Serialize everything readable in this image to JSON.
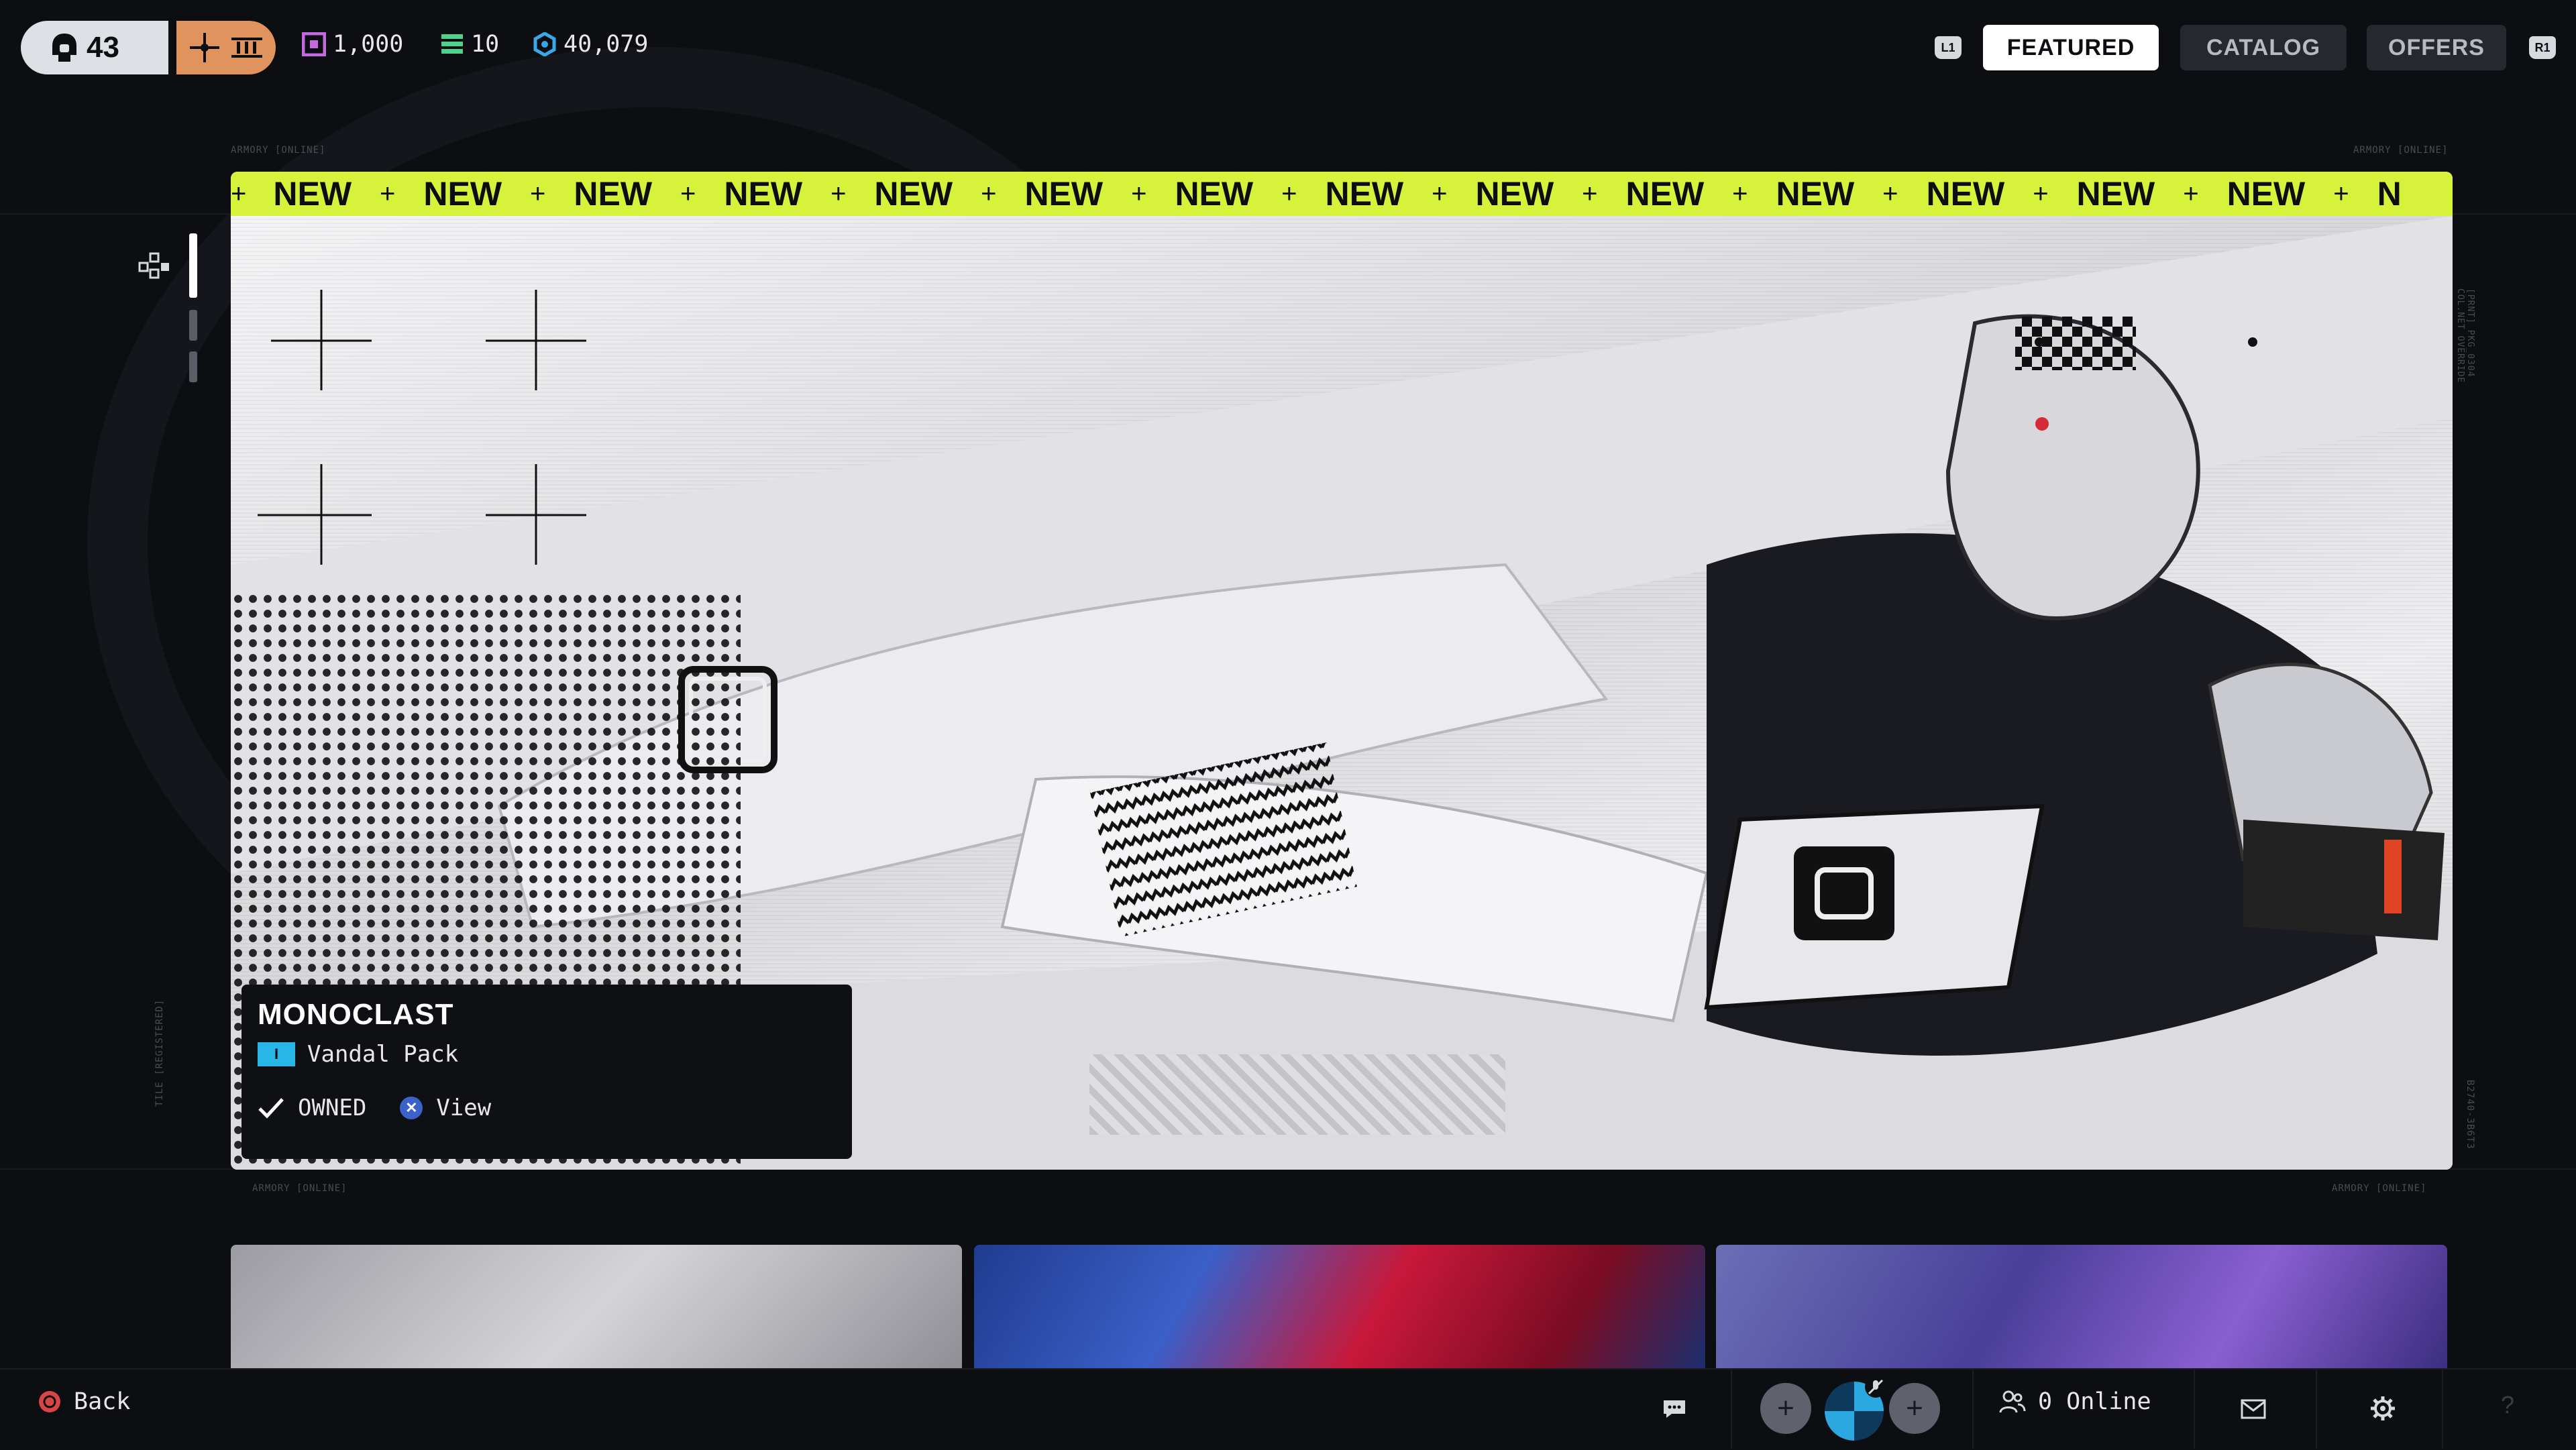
{
  "topbar": {
    "level": "43",
    "currencies": [
      {
        "icon": "square-token-icon",
        "value": "1,000",
        "color": "#c36adf"
      },
      {
        "icon": "stack-token-icon",
        "value": "10",
        "color": "#4fd18b"
      },
      {
        "icon": "hex-coin-icon",
        "value": "40,079",
        "color": "#39a8e8"
      }
    ],
    "nav": {
      "left_shoulder": "L1",
      "featured": "FEATURED",
      "catalog": "CATALOG",
      "offers": "OFFERS",
      "right_shoulder": "R1"
    }
  },
  "frame": {
    "label_top_left": "ARMORY [ONLINE]",
    "label_top_right": "ARMORY [ONLINE]",
    "label_bottom_left": "ARMORY [ONLINE]",
    "label_bottom_right": "ARMORY [ONLINE]",
    "side_left": "TILE [REGISTERED]",
    "side_right_top": "[PRNT] PKG_0304 COL.NET OVERRIDE",
    "side_right_bottom": "B2740-3B6T3"
  },
  "featured": {
    "ticker_word": "NEW",
    "ticker_count": 14,
    "ticker_tail": "N",
    "item": {
      "name": "MONOCLAST",
      "rarity": "I",
      "pack": "Vandal Pack",
      "status": "OWNED",
      "action": "View"
    }
  },
  "bottombar": {
    "back": "Back",
    "online": "0 Online"
  },
  "colors": {
    "accent_lime": "#d6f23a",
    "tier_orange": "#e0935c",
    "rarity_blue": "#27b6e6"
  }
}
